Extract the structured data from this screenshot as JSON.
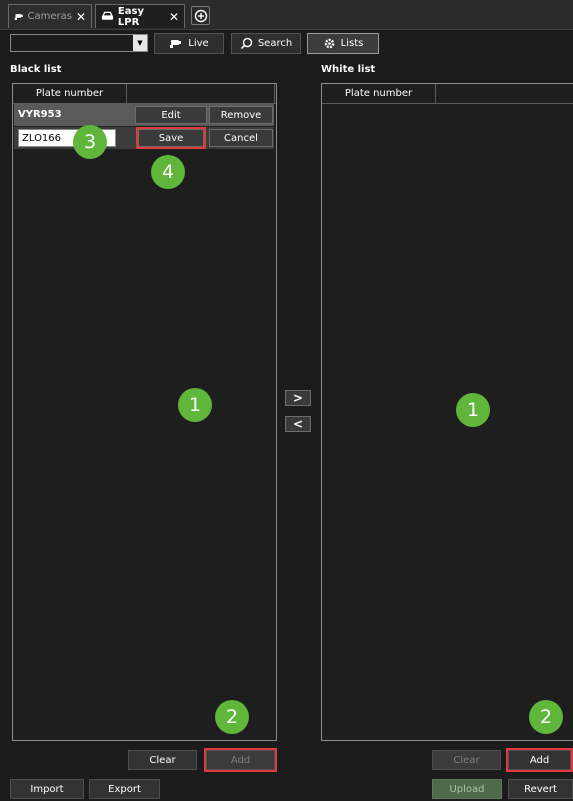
{
  "tabs": [
    {
      "label": "Cameras",
      "icon": "camera-icon",
      "close": "✕"
    },
    {
      "label": "Easy LPR",
      "icon": "car-icon",
      "close": "✕"
    }
  ],
  "add_tab_icon": "add-tab-icon",
  "toolbar": {
    "combo_value": "",
    "live_label": "Live",
    "search_label": "Search",
    "lists_label": "Lists"
  },
  "black_list": {
    "title": "Black list",
    "column": "Plate number",
    "rows": [
      {
        "plate": "VYR953",
        "edit": "Edit",
        "remove": "Remove"
      }
    ],
    "editing_value": "ZLO166",
    "save_label": "Save",
    "cancel_label": "Cancel",
    "clear_label": "Clear",
    "add_label": "Add",
    "import_label": "Import",
    "export_label": "Export"
  },
  "white_list": {
    "title": "White list",
    "column": "Plate number",
    "clear_label": "Clear",
    "add_label": "Add",
    "upload_label": "Upload",
    "revert_label": "Revert"
  },
  "move": {
    "to_white": ">",
    "to_black": "<"
  },
  "callouts": {
    "one": "1",
    "two": "2",
    "three": "3",
    "four": "4"
  },
  "colors": {
    "accent_green": "#5fb63a",
    "highlight_red": "#e03b3b"
  }
}
